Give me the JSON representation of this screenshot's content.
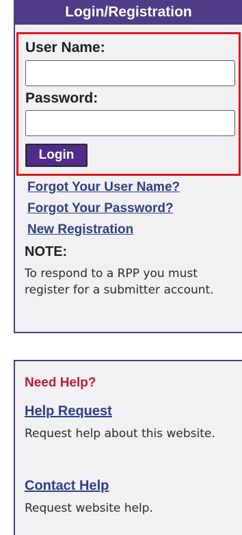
{
  "login_panel": {
    "header": "Login/Registration",
    "username_label": "User Name:",
    "username_value": "",
    "password_label": "Password:",
    "password_value": "",
    "login_button": "Login",
    "links": {
      "forgot_username": "Forgot Your User Name?",
      "forgot_password": "Forgot Your Password?",
      "new_registration": "New Registration"
    },
    "note_label": "NOTE:",
    "note_text": "To respond to a RPP you must register for a submitter account."
  },
  "help_panel": {
    "title": "Need Help?",
    "help_request_link": "Help Request",
    "help_request_text": "Request help about this website.",
    "contact_help_link": "Contact Help",
    "contact_help_text": "Request website help."
  },
  "colors": {
    "header_bg": "#4f3b86",
    "button_bg": "#4f2b8a",
    "highlight_border": "#e8141a",
    "link": "#2f3f86",
    "help_title": "#c21a35",
    "panel_bg": "#f1f1f4"
  }
}
